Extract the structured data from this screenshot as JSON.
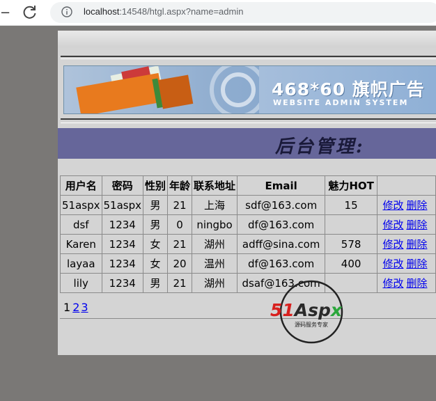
{
  "browser": {
    "url_host": "localhost",
    "url_rest": ":14548/htgl.aspx?name=admin"
  },
  "banner": {
    "title": "468*60 旗帜广告",
    "subtitle": "WEBSITE ADMIN SYSTEM"
  },
  "header": {
    "title": "后台管理:"
  },
  "table": {
    "columns": [
      "用户名",
      "密码",
      "性别",
      "年龄",
      "联系地址",
      "Email",
      "魅力HOT",
      ""
    ],
    "rows": [
      {
        "name": "51aspx",
        "password": "51aspx",
        "gender": "男",
        "age": "21",
        "address": "上海",
        "email": "sdf@163.com",
        "hot": "15"
      },
      {
        "name": "dsf",
        "password": "1234",
        "gender": "男",
        "age": "0",
        "address": "ningbo",
        "email": "df@163.com",
        "hot": ""
      },
      {
        "name": "Karen",
        "password": "1234",
        "gender": "女",
        "age": "21",
        "address": "湖州",
        "email": "adff@sina.com",
        "hot": "578"
      },
      {
        "name": "layaa",
        "password": "1234",
        "gender": "女",
        "age": "20",
        "address": "温州",
        "email": "df@163.com",
        "hot": "400"
      },
      {
        "name": "lily",
        "password": "1234",
        "gender": "男",
        "age": "21",
        "address": "湖州",
        "email": "dsaf@163.com",
        "hot": ""
      }
    ],
    "edit_label": "修改",
    "delete_label": "删除"
  },
  "pager": {
    "current": "1",
    "pages": [
      "2",
      "3"
    ]
  },
  "watermark": {
    "brand": "51Aspx",
    "tagline": "源码服务专家"
  },
  "colors": {
    "header_bar": "#66669a",
    "link": "#0000ee",
    "page_bg": "#d4d4d4"
  }
}
